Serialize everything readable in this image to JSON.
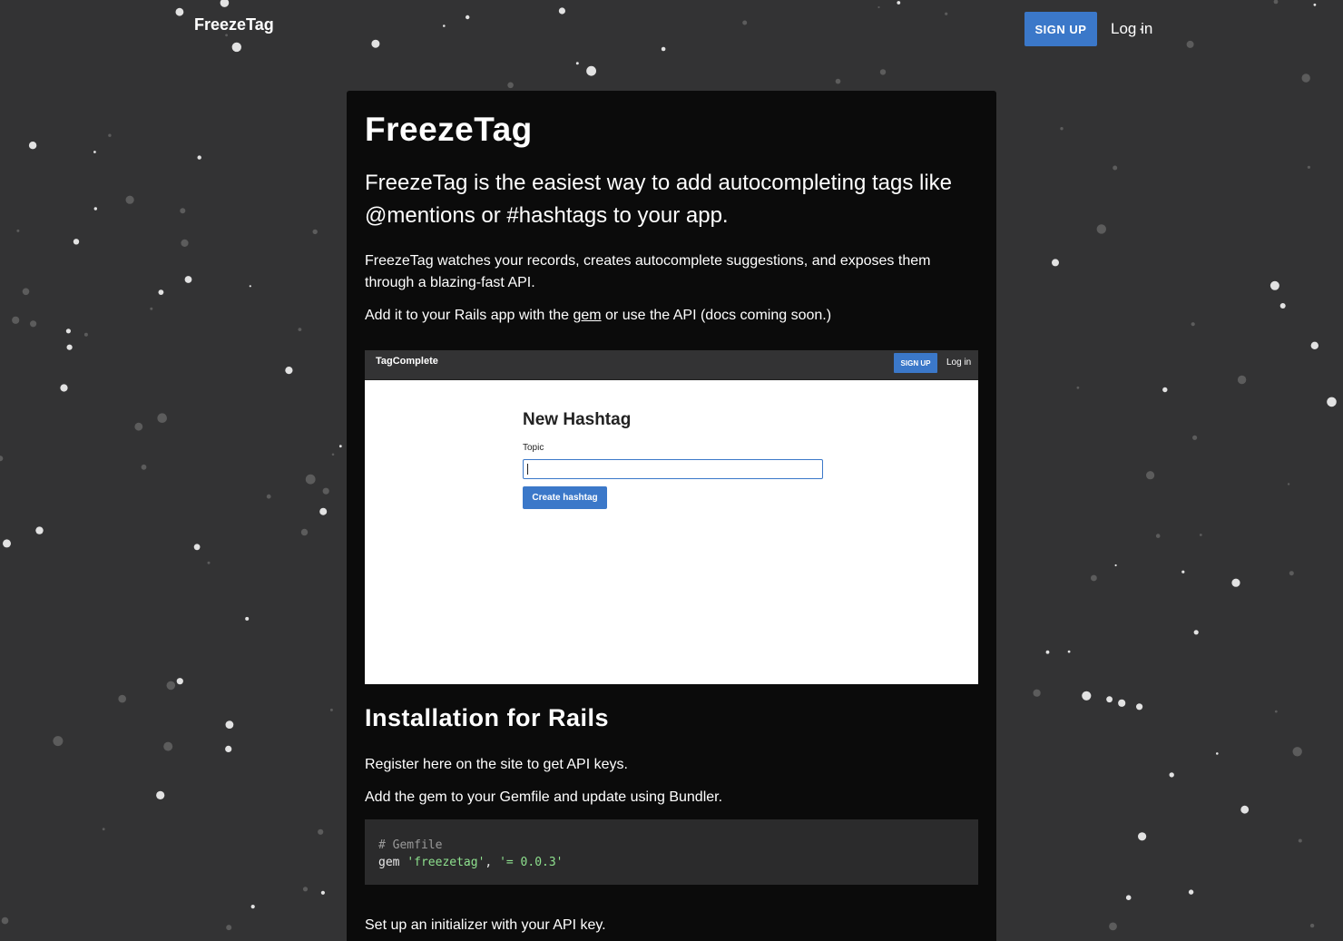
{
  "nav": {
    "brand": "FreezeTag",
    "signup_label": "SIGN UP",
    "login_label": "Log in"
  },
  "colors": {
    "background": "#333334",
    "card": "#0b0b0b",
    "accent": "#3b78c9",
    "code_bg": "#2b2b2c",
    "code_string": "#8ee08e"
  },
  "content": {
    "title": "FreezeTag",
    "lead": "FreezeTag is the easiest way to add autocompleting tags like @mentions or #hashtags to your app.",
    "para1": "FreezeTag watches your records, creates autocomplete suggestions, and exposes them through a blazing-fast API.",
    "para2_before": "Add it to your Rails app with the ",
    "para2_link": "gem",
    "para2_after": " or use the API (docs coming soon.)",
    "install_heading": "Installation for Rails",
    "install_p1": "Register here on the site to get API keys.",
    "install_p2": "Add the gem to your Gemfile and update using Bundler.",
    "code_comment": "# Gemfile",
    "code_gem": "gem ",
    "code_name": "'freezetag'",
    "code_sep": ", ",
    "code_version": "'= 0.0.3'",
    "install_p3": "Set up an initializer with your API key."
  },
  "screenshot": {
    "brand": "TagComplete",
    "signup_label": "SIGN UP",
    "login_label": "Log in",
    "heading": "New Hashtag",
    "field_label": "Topic",
    "button_label": "Create hashtag"
  }
}
